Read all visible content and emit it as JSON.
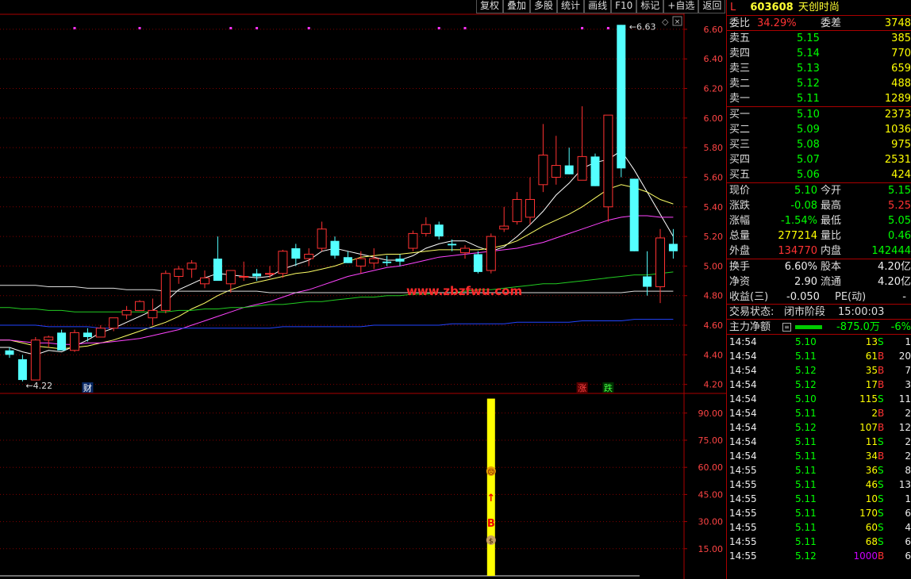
{
  "toolbar": [
    "复权",
    "叠加",
    "多股",
    "统计",
    "画线",
    "F10",
    "标记",
    "+自选",
    "返回"
  ],
  "stock": {
    "market": "L",
    "code": "603608",
    "name": "天创时尚"
  },
  "weibi": {
    "label": "委比",
    "value": "34.29%",
    "diff_label": "委差",
    "diff": "3748"
  },
  "asks": [
    {
      "label": "卖五",
      "price": "5.15",
      "vol": "385"
    },
    {
      "label": "卖四",
      "price": "5.14",
      "vol": "770"
    },
    {
      "label": "卖三",
      "price": "5.13",
      "vol": "659"
    },
    {
      "label": "卖二",
      "price": "5.12",
      "vol": "488"
    },
    {
      "label": "卖一",
      "price": "5.11",
      "vol": "1289"
    }
  ],
  "bids": [
    {
      "label": "买一",
      "price": "5.10",
      "vol": "2373"
    },
    {
      "label": "买二",
      "price": "5.09",
      "vol": "1036"
    },
    {
      "label": "买三",
      "price": "5.08",
      "vol": "975"
    },
    {
      "label": "买四",
      "price": "5.07",
      "vol": "2531"
    },
    {
      "label": "买五",
      "price": "5.06",
      "vol": "424"
    }
  ],
  "quote": [
    {
      "l1": "现价",
      "v1": "5.10",
      "c1": "green",
      "l2": "今开",
      "v2": "5.15",
      "c2": "green"
    },
    {
      "l1": "涨跌",
      "v1": "-0.08",
      "c1": "green",
      "l2": "最高",
      "v2": "5.25",
      "c2": "red"
    },
    {
      "l1": "涨幅",
      "v1": "-1.54%",
      "c1": "green",
      "l2": "最低",
      "v2": "5.05",
      "c2": "green"
    },
    {
      "l1": "总量",
      "v1": "277214",
      "c1": "yellow",
      "l2": "量比",
      "v2": "0.46",
      "c2": "green"
    },
    {
      "l1": "外盘",
      "v1": "134770",
      "c1": "red",
      "l2": "内盘",
      "v2": "142444",
      "c2": "green"
    }
  ],
  "fundamentals": [
    {
      "l1": "换手",
      "v1": "6.60%",
      "l2": "股本",
      "v2": "4.20亿"
    },
    {
      "l1": "净资",
      "v1": "2.90",
      "l2": "流通",
      "v2": "4.20亿"
    }
  ],
  "eps": {
    "label": "收益(三)",
    "value": "-0.050",
    "pe_label": "PE(动)",
    "pe": "-"
  },
  "trade_status": {
    "label": "交易状态:",
    "phase": "闭市阶段",
    "time": "15:00:03"
  },
  "main_force": {
    "label": "主力净额",
    "value": "-875.0万",
    "pct": "-6%"
  },
  "ticks": [
    {
      "t": "14:54",
      "p": "5.10",
      "v": "13",
      "s": "S",
      "n": "1"
    },
    {
      "t": "14:54",
      "p": "5.11",
      "v": "61",
      "s": "B",
      "n": "20"
    },
    {
      "t": "14:54",
      "p": "5.12",
      "v": "35",
      "s": "B",
      "n": "7"
    },
    {
      "t": "14:54",
      "p": "5.12",
      "v": "17",
      "s": "B",
      "n": "3"
    },
    {
      "t": "14:54",
      "p": "5.10",
      "v": "115",
      "s": "S",
      "n": "11"
    },
    {
      "t": "14:54",
      "p": "5.11",
      "v": "2",
      "s": "B",
      "n": "2"
    },
    {
      "t": "14:54",
      "p": "5.12",
      "v": "107",
      "s": "B",
      "n": "12"
    },
    {
      "t": "14:54",
      "p": "5.11",
      "v": "11",
      "s": "S",
      "n": "2"
    },
    {
      "t": "14:54",
      "p": "5.11",
      "v": "34",
      "s": "B",
      "n": "2"
    },
    {
      "t": "14:55",
      "p": "5.11",
      "v": "36",
      "s": "S",
      "n": "8"
    },
    {
      "t": "14:55",
      "p": "5.11",
      "v": "46",
      "s": "S",
      "n": "13"
    },
    {
      "t": "14:55",
      "p": "5.11",
      "v": "10",
      "s": "S",
      "n": "1"
    },
    {
      "t": "14:55",
      "p": "5.11",
      "v": "170",
      "s": "S",
      "n": "6"
    },
    {
      "t": "14:55",
      "p": "5.11",
      "v": "60",
      "s": "S",
      "n": "4"
    },
    {
      "t": "14:55",
      "p": "5.11",
      "v": "68",
      "s": "S",
      "n": "6"
    },
    {
      "t": "14:55",
      "p": "5.12",
      "v": "1000",
      "s": "B",
      "n": "6"
    }
  ],
  "watermark": "www.zbzfwu.com",
  "colors": {
    "up": "#ff3232",
    "down": "#54ffff",
    "ma5": "#ffffff",
    "ma10": "#ffff66",
    "ma20": "#ff44ff",
    "ma60": "#22cc22",
    "ma120": "#2244ff",
    "grid": "#800000",
    "indicator": "#ffff00"
  },
  "chart_data": [
    {
      "type": "candlestick",
      "ylim": [
        4.15,
        6.68
      ],
      "y_ticks": [
        "6.60",
        "6.40",
        "6.20",
        "6.00",
        "5.80",
        "5.60",
        "5.40",
        "5.20",
        "5.00",
        "4.80",
        "4.60",
        "4.40",
        "4.20"
      ],
      "annotations": {
        "high_label": "6.63",
        "low_label": "4.22"
      },
      "markers": [
        {
          "text": "财",
          "index": 6
        },
        {
          "text": "涨",
          "index": 44
        },
        {
          "text": "跌",
          "index": 46
        }
      ],
      "candles": [
        {
          "o": 4.43,
          "h": 4.45,
          "l": 4.38,
          "c": 4.4
        },
        {
          "o": 4.37,
          "h": 4.4,
          "l": 4.22,
          "c": 4.23
        },
        {
          "o": 4.23,
          "h": 4.52,
          "l": 4.23,
          "c": 4.5
        },
        {
          "o": 4.5,
          "h": 4.53,
          "l": 4.45,
          "c": 4.52
        },
        {
          "o": 4.55,
          "h": 4.57,
          "l": 4.43,
          "c": 4.43
        },
        {
          "o": 4.43,
          "h": 4.57,
          "l": 4.42,
          "c": 4.55
        },
        {
          "o": 4.55,
          "h": 4.58,
          "l": 4.49,
          "c": 4.52
        },
        {
          "o": 4.52,
          "h": 4.6,
          "l": 4.52,
          "c": 4.58
        },
        {
          "o": 4.58,
          "h": 4.65,
          "l": 4.56,
          "c": 4.65
        },
        {
          "o": 4.67,
          "h": 4.73,
          "l": 4.64,
          "c": 4.7
        },
        {
          "o": 4.7,
          "h": 4.77,
          "l": 4.7,
          "c": 4.76
        },
        {
          "o": 4.65,
          "h": 4.78,
          "l": 4.6,
          "c": 4.7
        },
        {
          "o": 4.7,
          "h": 4.97,
          "l": 4.68,
          "c": 4.95
        },
        {
          "o": 4.93,
          "h": 5.0,
          "l": 4.88,
          "c": 4.98
        },
        {
          "o": 4.98,
          "h": 5.04,
          "l": 4.92,
          "c": 5.02
        },
        {
          "o": 4.88,
          "h": 4.97,
          "l": 4.85,
          "c": 4.92
        },
        {
          "o": 5.05,
          "h": 5.2,
          "l": 4.97,
          "c": 4.9
        },
        {
          "o": 4.88,
          "h": 4.97,
          "l": 4.82,
          "c": 4.97
        },
        {
          "o": 4.93,
          "h": 5.03,
          "l": 4.9,
          "c": 4.93
        },
        {
          "o": 4.95,
          "h": 4.98,
          "l": 4.9,
          "c": 4.93
        },
        {
          "o": 4.95,
          "h": 5.0,
          "l": 4.92,
          "c": 4.95
        },
        {
          "o": 4.95,
          "h": 5.11,
          "l": 4.92,
          "c": 5.1
        },
        {
          "o": 5.12,
          "h": 5.15,
          "l": 5.0,
          "c": 5.05
        },
        {
          "o": 5.05,
          "h": 5.12,
          "l": 5.0,
          "c": 5.08
        },
        {
          "o": 5.12,
          "h": 5.3,
          "l": 5.1,
          "c": 5.25
        },
        {
          "o": 5.17,
          "h": 5.2,
          "l": 5.05,
          "c": 5.07
        },
        {
          "o": 5.06,
          "h": 5.1,
          "l": 5.02,
          "c": 5.02
        },
        {
          "o": 5.0,
          "h": 5.1,
          "l": 4.95,
          "c": 5.05
        },
        {
          "o": 5.02,
          "h": 5.12,
          "l": 4.98,
          "c": 5.05
        },
        {
          "o": 5.03,
          "h": 5.07,
          "l": 5.0,
          "c": 5.02
        },
        {
          "o": 5.05,
          "h": 5.08,
          "l": 5.0,
          "c": 5.03
        },
        {
          "o": 5.12,
          "h": 5.24,
          "l": 5.1,
          "c": 5.22
        },
        {
          "o": 5.22,
          "h": 5.33,
          "l": 5.2,
          "c": 5.28
        },
        {
          "o": 5.28,
          "h": 5.3,
          "l": 5.18,
          "c": 5.2
        },
        {
          "o": 5.15,
          "h": 5.18,
          "l": 5.1,
          "c": 5.14
        },
        {
          "o": 5.09,
          "h": 5.14,
          "l": 5.05,
          "c": 5.12
        },
        {
          "o": 5.08,
          "h": 5.1,
          "l": 4.95,
          "c": 4.96
        },
        {
          "o": 4.97,
          "h": 5.22,
          "l": 4.95,
          "c": 5.2
        },
        {
          "o": 5.25,
          "h": 5.4,
          "l": 5.23,
          "c": 5.27
        },
        {
          "o": 5.3,
          "h": 5.5,
          "l": 5.28,
          "c": 5.45
        },
        {
          "o": 5.33,
          "h": 5.6,
          "l": 5.28,
          "c": 5.45
        },
        {
          "o": 5.55,
          "h": 5.96,
          "l": 5.5,
          "c": 5.75
        },
        {
          "o": 5.6,
          "h": 5.88,
          "l": 5.55,
          "c": 5.68
        },
        {
          "o": 5.68,
          "h": 5.8,
          "l": 5.62,
          "c": 5.62
        },
        {
          "o": 5.58,
          "h": 6.08,
          "l": 5.58,
          "c": 5.74
        },
        {
          "o": 5.74,
          "h": 5.76,
          "l": 5.54,
          "c": 5.54
        },
        {
          "o": 5.4,
          "h": 6.02,
          "l": 5.3,
          "c": 6.02
        },
        {
          "o": 6.63,
          "h": 6.63,
          "l": 5.6,
          "c": 5.66
        },
        {
          "o": 5.59,
          "h": 5.59,
          "l": 5.1,
          "c": 5.1
        },
        {
          "o": 4.93,
          "h": 5.1,
          "l": 4.8,
          "c": 4.86
        },
        {
          "o": 4.86,
          "h": 5.25,
          "l": 4.75,
          "c": 5.19
        },
        {
          "o": 5.15,
          "h": 5.25,
          "l": 5.05,
          "c": 5.1
        }
      ],
      "ma_series": [
        {
          "key": "ma5",
          "values": [
            4.45,
            4.42,
            4.4,
            4.43,
            4.42,
            4.46,
            4.5,
            4.55,
            4.58,
            4.62,
            4.66,
            4.7,
            4.76,
            4.84,
            4.88,
            4.92,
            4.95,
            4.94,
            4.93,
            4.92,
            4.93,
            4.98,
            5.01,
            5.04,
            5.1,
            5.12,
            5.1,
            5.08,
            5.06,
            5.04,
            5.04,
            5.07,
            5.12,
            5.15,
            5.17,
            5.17,
            5.13,
            5.1,
            5.13,
            5.2,
            5.28,
            5.37,
            5.48,
            5.56,
            5.66,
            5.7,
            5.72,
            5.78,
            5.65,
            5.5,
            5.35,
            5.2
          ]
        },
        {
          "key": "ma10",
          "values": [
            4.5,
            4.48,
            4.46,
            4.45,
            4.44,
            4.45,
            4.46,
            4.48,
            4.5,
            4.53,
            4.56,
            4.59,
            4.62,
            4.66,
            4.71,
            4.75,
            4.8,
            4.84,
            4.87,
            4.89,
            4.91,
            4.93,
            4.95,
            4.96,
            4.98,
            5.0,
            5.03,
            5.06,
            5.07,
            5.08,
            5.08,
            5.09,
            5.1,
            5.11,
            5.11,
            5.11,
            5.11,
            5.12,
            5.14,
            5.17,
            5.22,
            5.27,
            5.31,
            5.35,
            5.4,
            5.46,
            5.52,
            5.55,
            5.53,
            5.5,
            5.45,
            5.42
          ]
        },
        {
          "key": "ma20",
          "values": [
            4.5,
            4.49,
            4.48,
            4.48,
            4.47,
            4.47,
            4.48,
            4.48,
            4.49,
            4.5,
            4.51,
            4.53,
            4.55,
            4.57,
            4.6,
            4.63,
            4.66,
            4.69,
            4.72,
            4.74,
            4.76,
            4.79,
            4.82,
            4.84,
            4.87,
            4.9,
            4.93,
            4.95,
            4.97,
            4.99,
            5.0,
            5.02,
            5.04,
            5.06,
            5.07,
            5.08,
            5.09,
            5.1,
            5.11,
            5.12,
            5.14,
            5.16,
            5.19,
            5.22,
            5.25,
            5.28,
            5.31,
            5.33,
            5.34,
            5.34,
            5.33,
            5.33
          ]
        },
        {
          "key": "ma60",
          "values": [
            4.72,
            4.71,
            4.71,
            4.7,
            4.7,
            4.69,
            4.69,
            4.69,
            4.69,
            4.69,
            4.69,
            4.69,
            4.69,
            4.7,
            4.7,
            4.71,
            4.71,
            4.72,
            4.72,
            4.73,
            4.74,
            4.74,
            4.75,
            4.76,
            4.76,
            4.77,
            4.78,
            4.79,
            4.79,
            4.8,
            4.8,
            4.81,
            4.81,
            4.82,
            4.82,
            4.83,
            4.84,
            4.84,
            4.85,
            4.86,
            4.87,
            4.88,
            4.88,
            4.89,
            4.9,
            4.91,
            4.92,
            4.93,
            4.94,
            4.94,
            4.95,
            4.96
          ]
        },
        {
          "key": "ma120",
          "values": [
            4.6,
            4.6,
            4.6,
            4.59,
            4.59,
            4.59,
            4.59,
            4.58,
            4.58,
            4.58,
            4.58,
            4.58,
            4.58,
            4.58,
            4.58,
            4.58,
            4.58,
            4.58,
            4.58,
            4.58,
            4.58,
            4.59,
            4.59,
            4.59,
            4.59,
            4.59,
            4.59,
            4.59,
            4.6,
            4.6,
            4.6,
            4.6,
            4.6,
            4.6,
            4.61,
            4.61,
            4.61,
            4.61,
            4.61,
            4.62,
            4.62,
            4.62,
            4.62,
            4.62,
            4.63,
            4.63,
            4.63,
            4.63,
            4.64,
            4.64,
            4.64,
            4.64
          ]
        },
        {
          "key": "ma250",
          "values": [
            4.87,
            4.87,
            4.87,
            4.86,
            4.86,
            4.86,
            4.85,
            4.85,
            4.85,
            4.84,
            4.84,
            4.84,
            4.83,
            4.83,
            4.83,
            4.83,
            4.83,
            4.83,
            4.83,
            4.83,
            4.82,
            4.82,
            4.82,
            4.82,
            4.82,
            4.82,
            4.82,
            4.82,
            4.82,
            4.82,
            4.82,
            4.82,
            4.82,
            4.82,
            4.82,
            4.82,
            4.82,
            4.82,
            4.82,
            4.82,
            4.82,
            4.82,
            4.82,
            4.82,
            4.82,
            4.82,
            4.82,
            4.82,
            4.83,
            4.83,
            4.83,
            4.83
          ]
        }
      ],
      "signal_dots": [
        5,
        10,
        17,
        19,
        23,
        33,
        35,
        44,
        46
      ]
    },
    {
      "type": "bar",
      "ylim": [
        0,
        100
      ],
      "y_ticks": [
        "90.00",
        "75.00",
        "60.00",
        "45.00",
        "30.00",
        "15.00"
      ],
      "bars": [
        {
          "index": 37,
          "value": 98
        }
      ],
      "signals": [
        "☹",
        "↑",
        "B",
        "$"
      ]
    }
  ]
}
